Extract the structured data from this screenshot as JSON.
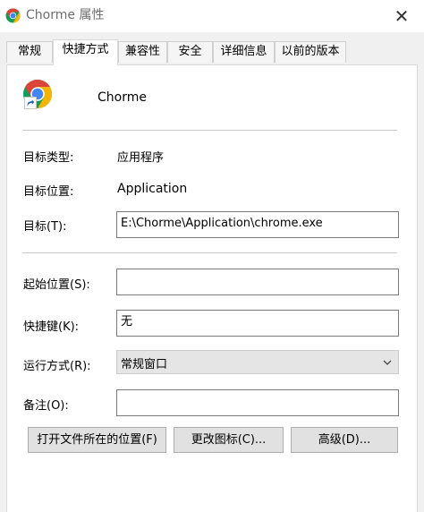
{
  "window": {
    "title": "Chorme 属性",
    "close_glyph": "✕"
  },
  "tabs": [
    {
      "label": "常规",
      "active": false
    },
    {
      "label": "快捷方式",
      "active": true
    },
    {
      "label": "兼容性",
      "active": false
    },
    {
      "label": "安全",
      "active": false
    },
    {
      "label": "详细信息",
      "active": false
    },
    {
      "label": "以前的版本",
      "active": false
    }
  ],
  "app": {
    "name": "Chorme",
    "icon": "chrome-icon"
  },
  "fields": {
    "target_type_label": "目标类型:",
    "target_type_value": "应用程序",
    "target_location_label": "目标位置:",
    "target_location_value": "Application",
    "target_label": "目标(T):",
    "target_value": "E:\\Chorme\\Application\\chrome.exe",
    "start_in_label": "起始位置(S):",
    "start_in_value": "",
    "shortcut_key_label": "快捷键(K):",
    "shortcut_key_value": "无",
    "run_label": "运行方式(R):",
    "run_value": "常规窗口",
    "comment_label": "备注(O):",
    "comment_value": ""
  },
  "buttons": {
    "open_location": "打开文件所在的位置(F)",
    "change_icon": "更改图标(C)...",
    "advanced": "高级(D)..."
  },
  "colors": {
    "chrome_red": "#db4437",
    "chrome_yellow": "#f4b400",
    "chrome_green": "#0f9d58",
    "chrome_blue": "#4285f4"
  }
}
